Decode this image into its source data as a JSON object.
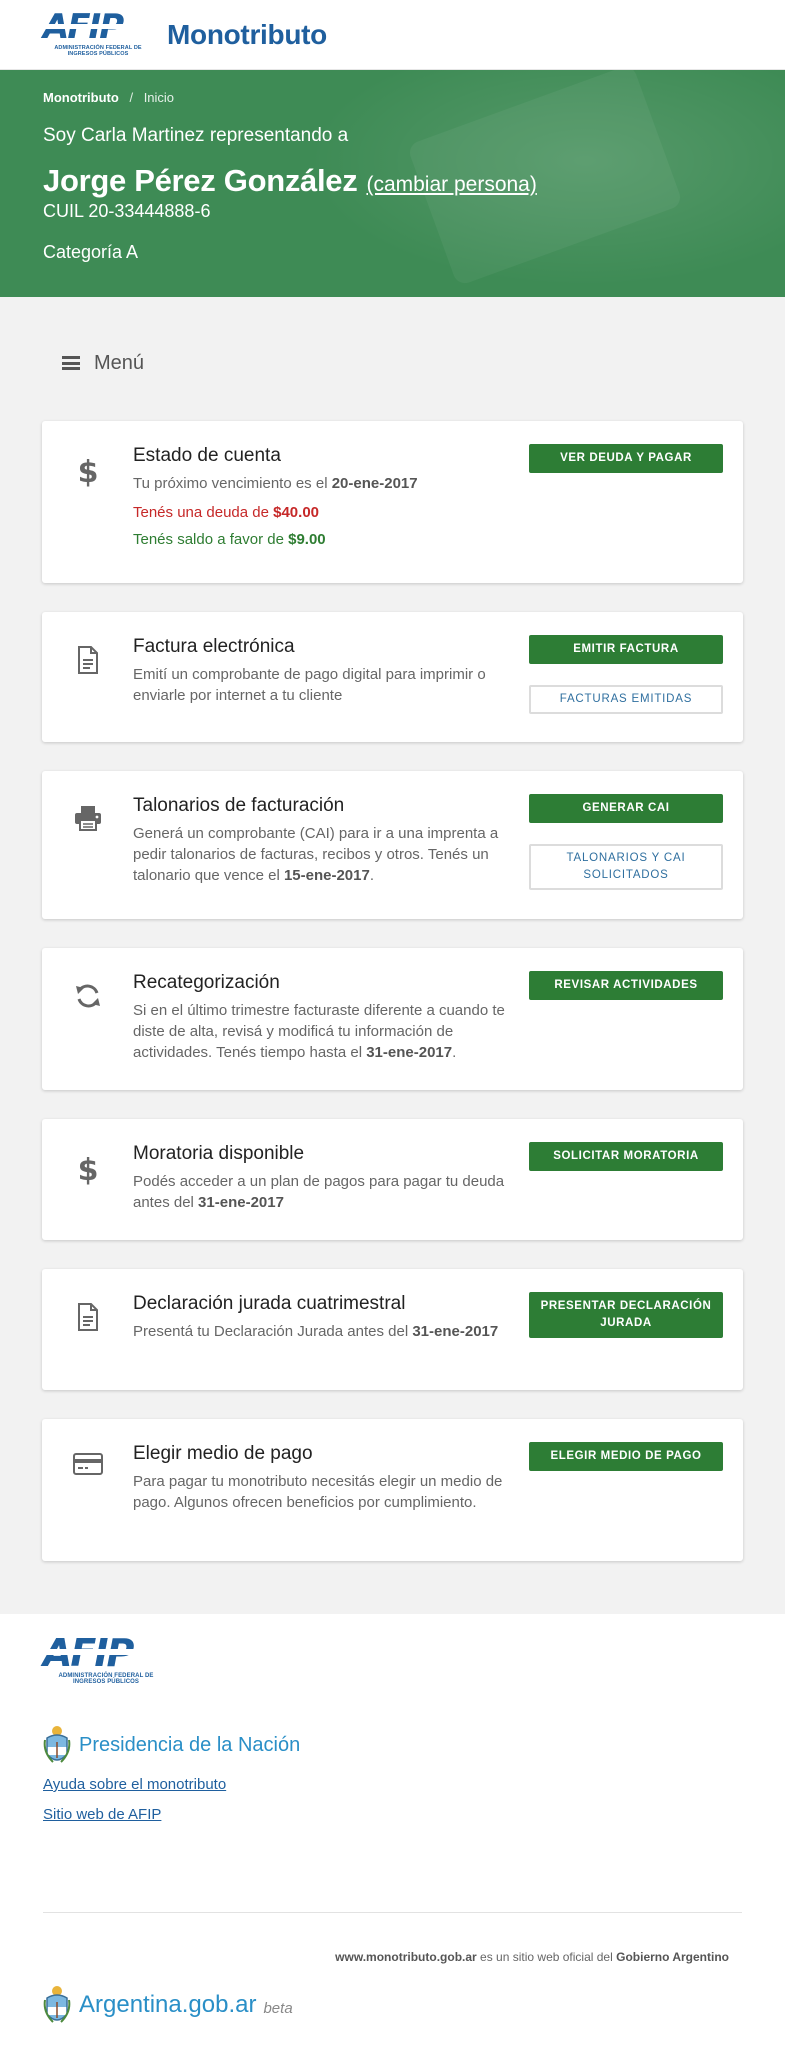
{
  "header": {
    "logo_text": "AFIP",
    "logo_subtitle": "ADMINISTRACIÓN FEDERAL DE INGRESOS PÚBLICOS",
    "app_title": "Monotributo"
  },
  "hero": {
    "breadcrumb": {
      "root": "Monotributo",
      "separator": "/",
      "current": "Inicio"
    },
    "representing": "Soy Carla Martinez representando a",
    "person_name": "Jorge Pérez González",
    "change_person": "(cambiar persona)",
    "cuil": "CUIL 20-33444888-6",
    "category": "Categoría A"
  },
  "menu": {
    "label": "Menú"
  },
  "cards": [
    {
      "title": "Estado de cuenta",
      "desc_pre": "Tu próximo vencimiento es el ",
      "desc_bold": "20-ene-2017",
      "debt_pre": "Tenés una deuda de ",
      "debt_amount": "$40.00",
      "credit_pre": "Tenés saldo a favor de ",
      "credit_amount": "$9.00",
      "primary": "VER DEUDA Y PAGAR"
    },
    {
      "title": "Factura electrónica",
      "desc": "Emití un comprobante de pago digital para imprimir o enviarle por internet a tu cliente",
      "primary": "EMITIR FACTURA",
      "secondary": "FACTURAS EMITIDAS"
    },
    {
      "title": "Talonarios de facturación",
      "desc_pre": "Generá un comprobante (CAI) para ir a una imprenta a pedir talonarios de facturas, recibos y otros. Tenés un talonario que vence el ",
      "desc_bold": "15-ene-2017",
      "desc_post": ".",
      "primary": "GENERAR CAI",
      "secondary": "TALONARIOS Y CAI SOLICITADOS"
    },
    {
      "title": "Recategorización",
      "desc_pre": "Si en el último trimestre facturaste diferente a cuando te diste de alta, revisá y modificá tu información de actividades. Tenés tiempo hasta el ",
      "desc_bold": "31-ene-2017",
      "desc_post": ".",
      "primary": "REVISAR ACTIVIDADES"
    },
    {
      "title": "Moratoria disponible",
      "desc_pre": "Podés acceder a un plan de pagos para pagar tu deuda antes del ",
      "desc_bold": "31-ene-2017",
      "primary": "SOLICITAR MORATORIA"
    },
    {
      "title": "Declaración jurada cuatrimestral",
      "desc_pre": "Presentá tu Declaración Jurada antes del ",
      "desc_bold": "31-ene-2017",
      "primary": "PRESENTAR DECLARACIÓN JURADA"
    },
    {
      "title": "Elegir medio de pago",
      "desc": "Para pagar tu monotributo necesitás elegir un medio de pago. Algunos ofrecen beneficios por cumplimiento.",
      "primary": "ELEGIR MEDIO DE PAGO"
    }
  ],
  "footer": {
    "logo_text": "AFIP",
    "logo_subtitle": "ADMINISTRACIÓN FEDERAL DE INGRESOS PÚBLICOS",
    "presidencia": "Presidencia de la Nación",
    "link_help": "Ayuda sobre el monotributo",
    "link_afip": "Sitio web de AFIP",
    "note_site": "www.monotributo.gob.ar",
    "note_mid": " es un sitio web oficial del ",
    "note_gov": "Gobierno Argentino",
    "argentina": "Argentina.gob.ar",
    "beta": "beta"
  },
  "icons": {
    "dollar": "dollar-icon",
    "document": "document-icon",
    "printer": "printer-icon",
    "refresh": "refresh-icon",
    "card": "credit-card-icon",
    "menu": "hamburger-icon",
    "shield": "coat-of-arms-icon"
  },
  "colors": {
    "brand_blue": "#1f5f9e",
    "hero_green": "#3e8b55",
    "button_green": "#2d7d35",
    "debt_red": "#c62828",
    "credit_green": "#2e7d32",
    "link_blue": "#2a8fc7"
  }
}
